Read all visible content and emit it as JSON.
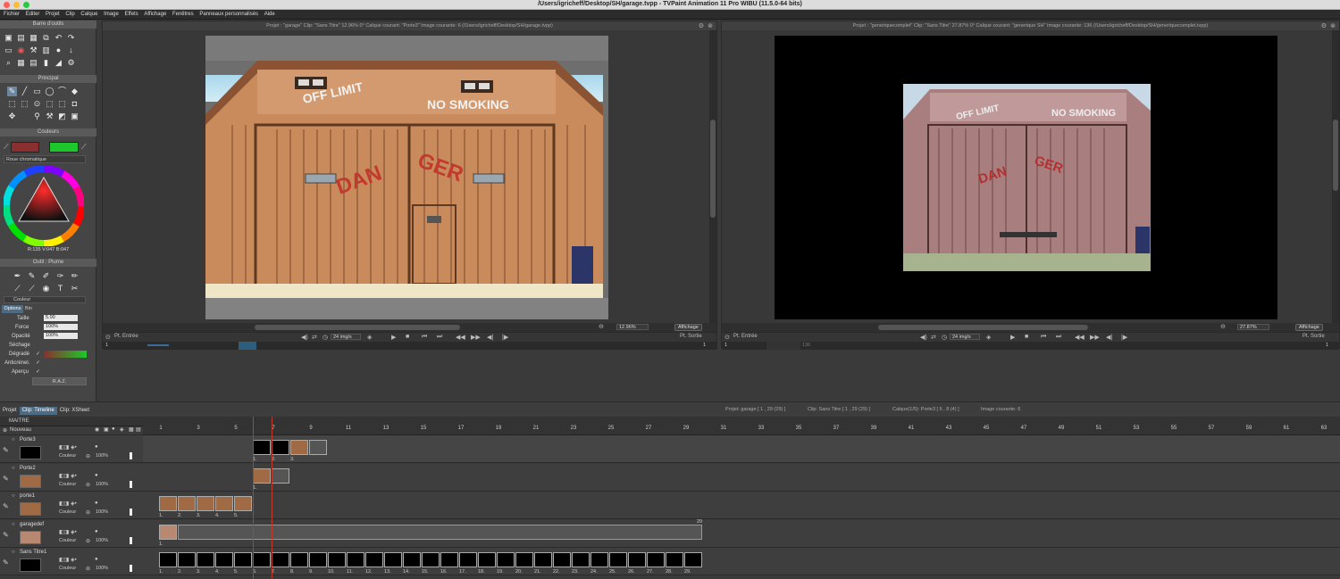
{
  "window": {
    "title": "/Users/igricheff/Desktop/SH/garage.tvpp - TVPaint Animation 11 Pro WIBU (11.5.0-64 bits)"
  },
  "menu": [
    "Fichier",
    "Editer",
    "Projet",
    "Clip",
    "Calque",
    "Image",
    "Effets",
    "Affichage",
    "Fenêtres",
    "Panneaux personnalisés",
    "Aide"
  ],
  "panels": {
    "tools_header": "Barre d'outils",
    "principal_header": "Principal",
    "colors_header": "Couleurs",
    "wheel_label": "Roue chromatique",
    "rgb_readout": "R:135 V:047 B:047",
    "pen_header": "Outil : Plume",
    "pen_mode": "Couleur",
    "options_tab": "Options",
    "bin_tab": "Bin",
    "size_label": "Taille",
    "size_value": "5.00",
    "force_label": "Force",
    "force_value": "100%",
    "opacity_label": "Opacité",
    "opacity_value": "100%",
    "sechage_label": "Séchage",
    "degrade_label": "Dégradé",
    "anticrenel_label": "Anticrénel.",
    "apercu_label": "Aperçu",
    "raz_label": "R.A.Z."
  },
  "viewer_left": {
    "header": "Projet : \"garage\"  Clip: \"Sans Titre\"  12.96%   0°  Calque courant: \"Porte3\"  Image courante: 6  (/Users/igricheff/Desktop/SH/garage.tvpp)",
    "zoom": "12.96%",
    "affichage": "Affichage",
    "pt_entree": "Pt. Entrée",
    "pt_sortie": "Pt. Sortie",
    "fps": "24 img/s",
    "start": "1",
    "end": "1"
  },
  "viewer_right": {
    "header": "Projet : \"generiquecomplet\"  Clip: \"Sans Titre\"   27.87%   0°  Calque courant: \"generique SH\"  Image courante: 136  (/Users/igricheff/Desktop/SH/generiquecomplet.tvpp)",
    "zoom": "27.87%",
    "affichage": "Affichage",
    "pt_entree": "Pt. Entrée",
    "pt_sortie": "Pt. Sortie",
    "fps": "24 img/s",
    "start": "1",
    "mid": "136",
    "end": "1"
  },
  "art": {
    "sign_left": "OFF LIMIT",
    "sign_right": "NO SMOKING",
    "danger_left": "DAN",
    "danger_right": "GER"
  },
  "info": {
    "projet": "Projet: garage [ 1 , 29  (29) ]",
    "clip": "Clip: Sans Titre [ 1 , 29  (29) ]",
    "calque": "Calque(1/5): Porte3 [ 6 , 8  (4) ]",
    "image": "Image courante: 6"
  },
  "tabs": [
    "Projet",
    "Clip: Timeline",
    "Clip: XSheet"
  ],
  "timeline": {
    "maitre": "MAITRE",
    "nouveau": "Nouveau",
    "ruler": [
      "1",
      "3",
      "5",
      "7",
      "9",
      "11",
      "13",
      "15",
      "17",
      "19",
      "21",
      "23",
      "25",
      "27",
      "29",
      "31",
      "33",
      "35",
      "37",
      "39",
      "41",
      "43",
      "45",
      "47",
      "49",
      "51",
      "53",
      "55",
      "57",
      "59",
      "61",
      "63"
    ],
    "layers": [
      {
        "name": "Porte3",
        "mode": "Couleur",
        "opacity": "100%"
      },
      {
        "name": "Porte2",
        "mode": "Couleur",
        "opacity": "100%"
      },
      {
        "name": "porte1",
        "mode": "Couleur",
        "opacity": "100%"
      },
      {
        "name": "garagedef",
        "mode": "Couleur",
        "opacity": "100%"
      },
      {
        "name": "Sans Titre1",
        "mode": "Couleur",
        "opacity": "100%"
      }
    ],
    "cell_labels_porte3": [
      "1.",
      "2.",
      "3."
    ],
    "cell_labels_porte1": [
      "1.",
      "2.",
      "3.",
      "4.",
      "5."
    ],
    "garagedef_end": "29",
    "sans_titre_labels": [
      "1.",
      "2.",
      "3.",
      "4.",
      "5.",
      "6.",
      "7.",
      "8.",
      "9.",
      "10.",
      "11.",
      "12.",
      "13.",
      "14.",
      "15.",
      "16.",
      "17.",
      "18.",
      "19.",
      "20.",
      "21.",
      "22.",
      "23.",
      "24.",
      "25.",
      "26.",
      "27.",
      "28.",
      "29."
    ]
  }
}
